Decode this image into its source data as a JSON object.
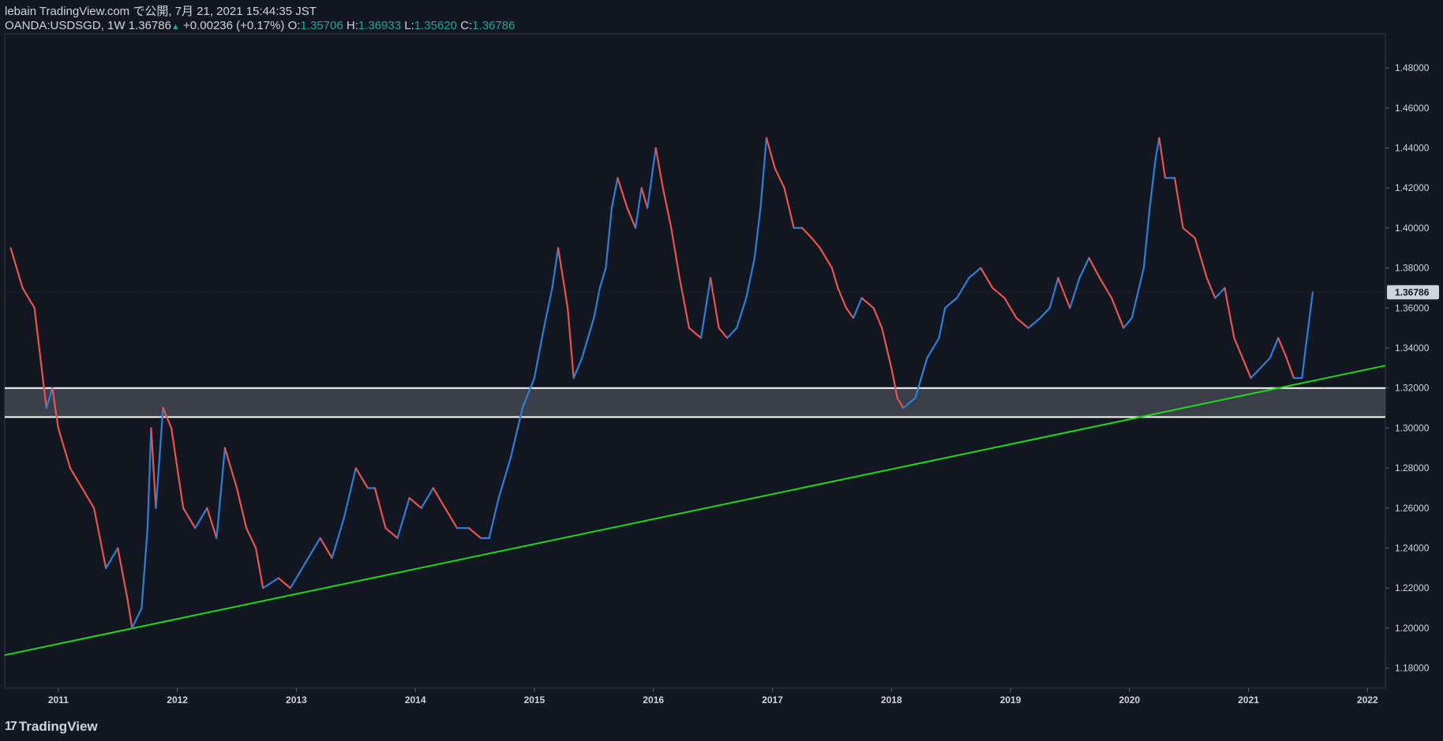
{
  "header": {
    "publisher": "lebain TradingView.com で公開, 7月 21, 2021 15:44:35 JST",
    "symbol": "OANDA:USDSGD, 1W",
    "last": "1.36786",
    "change": "+0.00236 (+0.17%)",
    "open_label": "O:",
    "open": "1.35706",
    "high_label": "H:",
    "high": "1.36933",
    "low_label": "L:",
    "low": "1.35620",
    "close_label": "C:",
    "close": "1.36786"
  },
  "footer": {
    "brand": "TradingView"
  },
  "colors": {
    "background": "#131722",
    "up": "#2f7fd8",
    "down": "#e8554e",
    "trendline": "#22d61b",
    "zone_line": "#ffffff",
    "zone_fill": "#4a4d57",
    "price_tag_bg": "#d1d4dc"
  },
  "chart_data": {
    "type": "line",
    "series": [
      {
        "values": [
          [
            2010.6,
            1.39
          ],
          [
            2010.7,
            1.37
          ],
          [
            2010.8,
            1.36
          ],
          [
            2010.9,
            1.31
          ],
          [
            2010.95,
            1.32
          ],
          [
            2011.0,
            1.3
          ],
          [
            2011.1,
            1.28
          ],
          [
            2011.2,
            1.27
          ],
          [
            2011.3,
            1.26
          ],
          [
            2011.4,
            1.23
          ],
          [
            2011.5,
            1.24
          ],
          [
            2011.58,
            1.215
          ],
          [
            2011.62,
            1.2
          ],
          [
            2011.7,
            1.21
          ],
          [
            2011.75,
            1.25
          ],
          [
            2011.78,
            1.3
          ],
          [
            2011.82,
            1.26
          ],
          [
            2011.88,
            1.31
          ],
          [
            2011.95,
            1.3
          ],
          [
            2012.05,
            1.26
          ],
          [
            2012.15,
            1.25
          ],
          [
            2012.25,
            1.26
          ],
          [
            2012.33,
            1.245
          ],
          [
            2012.4,
            1.29
          ],
          [
            2012.5,
            1.27
          ],
          [
            2012.58,
            1.25
          ],
          [
            2012.66,
            1.24
          ],
          [
            2012.72,
            1.22
          ],
          [
            2012.85,
            1.225
          ],
          [
            2012.95,
            1.22
          ],
          [
            2013.1,
            1.235
          ],
          [
            2013.2,
            1.245
          ],
          [
            2013.3,
            1.235
          ],
          [
            2013.4,
            1.255
          ],
          [
            2013.5,
            1.28
          ],
          [
            2013.6,
            1.27
          ],
          [
            2013.66,
            1.27
          ],
          [
            2013.75,
            1.25
          ],
          [
            2013.85,
            1.245
          ],
          [
            2013.95,
            1.265
          ],
          [
            2014.05,
            1.26
          ],
          [
            2014.15,
            1.27
          ],
          [
            2014.25,
            1.26
          ],
          [
            2014.35,
            1.25
          ],
          [
            2014.45,
            1.25
          ],
          [
            2014.55,
            1.245
          ],
          [
            2014.62,
            1.245
          ],
          [
            2014.7,
            1.265
          ],
          [
            2014.8,
            1.285
          ],
          [
            2014.9,
            1.31
          ],
          [
            2015.0,
            1.325
          ],
          [
            2015.08,
            1.35
          ],
          [
            2015.15,
            1.37
          ],
          [
            2015.2,
            1.39
          ],
          [
            2015.28,
            1.36
          ],
          [
            2015.33,
            1.325
          ],
          [
            2015.4,
            1.335
          ],
          [
            2015.5,
            1.355
          ],
          [
            2015.55,
            1.37
          ],
          [
            2015.6,
            1.38
          ],
          [
            2015.65,
            1.41
          ],
          [
            2015.7,
            1.425
          ],
          [
            2015.78,
            1.41
          ],
          [
            2015.85,
            1.4
          ],
          [
            2015.9,
            1.42
          ],
          [
            2015.95,
            1.41
          ],
          [
            2016.02,
            1.44
          ],
          [
            2016.08,
            1.42
          ],
          [
            2016.15,
            1.4
          ],
          [
            2016.22,
            1.375
          ],
          [
            2016.3,
            1.35
          ],
          [
            2016.4,
            1.345
          ],
          [
            2016.48,
            1.375
          ],
          [
            2016.55,
            1.35
          ],
          [
            2016.62,
            1.345
          ],
          [
            2016.7,
            1.35
          ],
          [
            2016.78,
            1.365
          ],
          [
            2016.85,
            1.385
          ],
          [
            2016.9,
            1.41
          ],
          [
            2016.95,
            1.445
          ],
          [
            2017.02,
            1.43
          ],
          [
            2017.1,
            1.42
          ],
          [
            2017.18,
            1.4
          ],
          [
            2017.25,
            1.4
          ],
          [
            2017.33,
            1.395
          ],
          [
            2017.4,
            1.39
          ],
          [
            2017.5,
            1.38
          ],
          [
            2017.55,
            1.37
          ],
          [
            2017.62,
            1.36
          ],
          [
            2017.68,
            1.355
          ],
          [
            2017.75,
            1.365
          ],
          [
            2017.85,
            1.36
          ],
          [
            2017.92,
            1.35
          ],
          [
            2018.0,
            1.33
          ],
          [
            2018.05,
            1.315
          ],
          [
            2018.1,
            1.31
          ],
          [
            2018.2,
            1.315
          ],
          [
            2018.3,
            1.335
          ],
          [
            2018.4,
            1.345
          ],
          [
            2018.45,
            1.36
          ],
          [
            2018.55,
            1.365
          ],
          [
            2018.65,
            1.375
          ],
          [
            2018.75,
            1.38
          ],
          [
            2018.85,
            1.37
          ],
          [
            2018.95,
            1.365
          ],
          [
            2019.05,
            1.355
          ],
          [
            2019.15,
            1.35
          ],
          [
            2019.25,
            1.355
          ],
          [
            2019.33,
            1.36
          ],
          [
            2019.4,
            1.375
          ],
          [
            2019.5,
            1.36
          ],
          [
            2019.58,
            1.375
          ],
          [
            2019.66,
            1.385
          ],
          [
            2019.75,
            1.375
          ],
          [
            2019.85,
            1.365
          ],
          [
            2019.95,
            1.35
          ],
          [
            2020.02,
            1.355
          ],
          [
            2020.12,
            1.38
          ],
          [
            2020.17,
            1.41
          ],
          [
            2020.22,
            1.435
          ],
          [
            2020.25,
            1.445
          ],
          [
            2020.3,
            1.425
          ],
          [
            2020.38,
            1.425
          ],
          [
            2020.45,
            1.4
          ],
          [
            2020.55,
            1.395
          ],
          [
            2020.65,
            1.375
          ],
          [
            2020.72,
            1.365
          ],
          [
            2020.8,
            1.37
          ],
          [
            2020.88,
            1.345
          ],
          [
            2020.95,
            1.335
          ],
          [
            2021.02,
            1.325
          ],
          [
            2021.1,
            1.33
          ],
          [
            2021.18,
            1.335
          ],
          [
            2021.25,
            1.345
          ],
          [
            2021.32,
            1.335
          ],
          [
            2021.38,
            1.325
          ],
          [
            2021.45,
            1.325
          ],
          [
            2021.48,
            1.34
          ],
          [
            2021.54,
            1.368
          ]
        ]
      }
    ],
    "x_ticks": [
      "2011",
      "2012",
      "2013",
      "2014",
      "2015",
      "2016",
      "2017",
      "2018",
      "2019",
      "2020",
      "2021",
      "2022"
    ],
    "y_ticks": [
      "1.48000",
      "1.46000",
      "1.44000",
      "1.42000",
      "1.40000",
      "1.38000",
      "1.36000",
      "1.34000",
      "1.32000",
      "1.30000",
      "1.28000",
      "1.26000",
      "1.24000",
      "1.22000",
      "1.20000",
      "1.18000"
    ],
    "xlim": [
      2010.55,
      2022.15
    ],
    "ylim": [
      1.17,
      1.497
    ],
    "price_tag": "1.36786",
    "last_price": 1.36786,
    "support_zone": [
      1.3055,
      1.32
    ],
    "trendline": [
      [
        2010.55,
        1.1865
      ],
      [
        2022.15,
        1.3312
      ]
    ],
    "title": "",
    "xlabel": "",
    "ylabel": "",
    "grid": false
  }
}
